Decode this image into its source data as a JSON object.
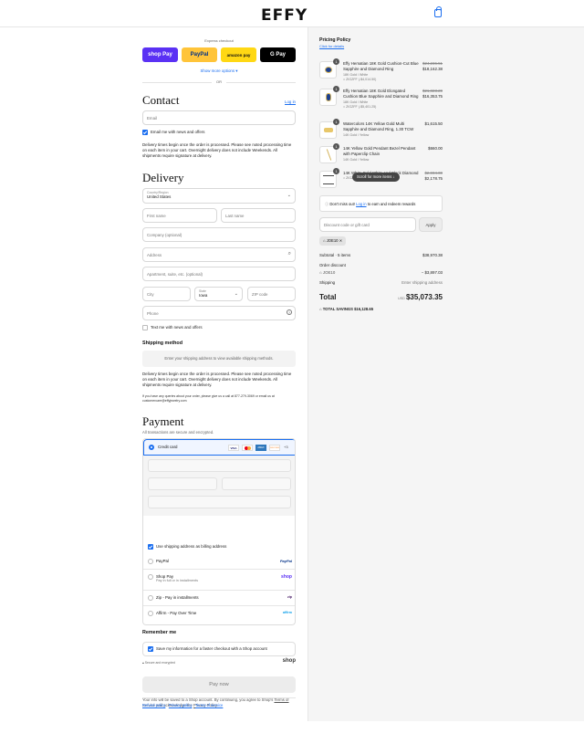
{
  "header": {
    "logo": "EFFY"
  },
  "express": {
    "title": "Express checkout",
    "shop_pay": "shop Pay",
    "paypal": "PayPal",
    "amazon": "amazon pay",
    "gpay": "G Pay",
    "show_more": "Show more options ▾",
    "or": "OR"
  },
  "contact": {
    "heading": "Contact",
    "login": "Log in",
    "email_placeholder": "Email",
    "news_label": "Email me with news and offers",
    "note": "Delivery times begin once the order is processed. Please see noted processing time on each item in your cart. Overnight delivery does not include Weekends. All shipments require signature at delivery."
  },
  "delivery": {
    "heading": "Delivery",
    "country_label": "Country/Region",
    "country": "United States",
    "first_name": "First name",
    "last_name": "Last name",
    "company": "Company (optional)",
    "address": "Address",
    "apartment": "Apartment, suite, etc. (optional)",
    "city": "City",
    "state_label": "State",
    "state": "Iowa",
    "zip": "ZIP code",
    "phone": "Phone",
    "text_label": "Text me with news and offers"
  },
  "shipping": {
    "heading": "Shipping method",
    "placeholder": "Enter your shipping address to view available shipping methods.",
    "note": "Delivery times begin once the order is processed. Please see noted processing time on each item in your cart. Overnight delivery does not include Weekends. All shipments require signature at delivery.",
    "contact_note": "If you have any queries about your order, please give us a call at 877-279-3069 or email us at customercare@effyjewelry.com"
  },
  "payment": {
    "heading": "Payment",
    "sub": "All transactions are secure and encrypted.",
    "credit_card": "Credit card",
    "cards": [
      "VISA",
      "MC",
      "AMEX",
      "DISCOVER"
    ],
    "more_cards": "+3",
    "billing_label": "Use shipping address as billing address",
    "options": [
      {
        "label": "PayPal",
        "sub": "",
        "brand": "PayPal"
      },
      {
        "label": "Shop Pay",
        "sub": "Pay in full or in installments",
        "brand": "shop"
      },
      {
        "label": "Zip - Pay in installments",
        "sub": "",
        "brand": "zip"
      },
      {
        "label": "Affirm - Pay Over Time",
        "sub": "",
        "brand": "affirm"
      }
    ]
  },
  "remember": {
    "heading": "Remember me",
    "save_label": "Save my information for a faster checkout with a Shop account",
    "secure": "Secure and encrypted",
    "shop": "shop"
  },
  "pay_now": "Pay now",
  "legal": {
    "text": "Your info will be saved to a Shop account. By continuing, you agree to Shop's",
    "tos": "Terms of Service",
    "and": "and acknowledge the",
    "privacy": "Privacy Policy."
  },
  "footer": {
    "refund": "Refund policy",
    "privacy": "Privacy policy",
    "terms": "Terms of service"
  },
  "summary": {
    "pricing_title": "Pricing Policy",
    "pricing_link": "Click for details",
    "items": [
      {
        "qty": "1",
        "title": "Effy Hematian 18K Gold Cushion-Cut Blue Sapphire and Diamond Ring",
        "variant": "18K Gold / White",
        "discount": "ZIGZFF (-$4,014.50)",
        "old": "$24,236.51",
        "price": "$18,162.38"
      },
      {
        "qty": "1",
        "title": "Effy Hematian 18K Gold Elongated Cushion Blue Sapphire and Diamond Ring",
        "variant": "18K Gold / White",
        "discount": "ZIGZFF (-$5,401.25)",
        "old": "$21,823.20",
        "price": "$16,353.75"
      },
      {
        "qty": "1",
        "title": "Watercolors 14K Yellow Gold Multi Sapphire and Diamond Ring, 1.30 TCW",
        "variant": "14K Gold / Yellow",
        "discount": "",
        "old": "",
        "price": "$1,615.50"
      },
      {
        "qty": "1",
        "title": "14K Yellow Gold Pendant Bezel Pendant with Paperclip Chain",
        "variant": "14K Gold / Yellow",
        "discount": "",
        "old": "",
        "price": "$660.00"
      },
      {
        "qty": "1",
        "title": "14K White Gold White and Black Diamond",
        "variant": "",
        "discount": "ZIGZFF (-$724.75)",
        "old": "$2,904.00",
        "price": "$2,178.75"
      }
    ],
    "scroll_hint": "Scroll for more items ↓",
    "loyalty": "Don't miss out!",
    "loyalty_link": "Log in",
    "loyalty_rest": "to earn and redeem rewards",
    "discount_placeholder": "Discount code or gift card",
    "apply": "Apply",
    "code_tag": "JOE10",
    "subtotal_label": "Subtotal · 5 items",
    "subtotal": "$38,970.38",
    "order_discount": "Order discount",
    "code": "JOE10",
    "discount_amount": "− $3,897.03",
    "shipping_label": "Shipping",
    "shipping_value": "Enter shipping address",
    "total_label": "Total",
    "currency": "USD",
    "total": "$35,073.35",
    "savings_label": "TOTAL SAVINGS",
    "savings": "$16,128.65"
  }
}
